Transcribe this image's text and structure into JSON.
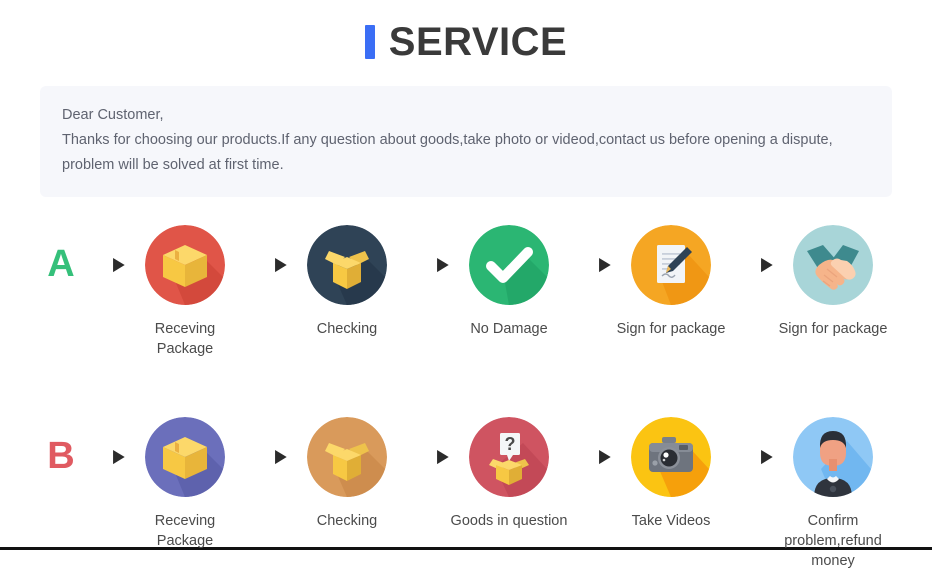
{
  "header": {
    "accent_color": "#3b6ef5",
    "title": "SERVICE"
  },
  "notice": {
    "line1": "Dear Customer,",
    "line2": "Thanks for choosing our products.If any question about goods,take photo or videod,contact us before opening a dispute,",
    "line3": "problem will be solved at first time.",
    "background": "#f6f7fb",
    "text_color": "#5f6370"
  },
  "flows": [
    {
      "letter": "A",
      "letter_color": "#35c07a",
      "steps": [
        {
          "icon": "package-box-icon",
          "label": "Receving Package",
          "circle_color": "#e05548"
        },
        {
          "icon": "open-box-icon",
          "label": "Checking",
          "circle_color": "#2f4356"
        },
        {
          "icon": "check-mark-icon",
          "label": "No Damage",
          "circle_color": "#2bb673"
        },
        {
          "icon": "sign-document-icon",
          "label": "Sign for package",
          "circle_color": "#f5a623"
        },
        {
          "icon": "handshake-icon",
          "label": "Sign for package",
          "circle_color": "#a8d5d8"
        }
      ]
    },
    {
      "letter": "B",
      "letter_color": "#e05a61",
      "steps": [
        {
          "icon": "package-box-icon",
          "label": "Receving Package",
          "circle_color": "#6b6fbb"
        },
        {
          "icon": "open-box-icon",
          "label": "Checking",
          "circle_color": "#d99a5b"
        },
        {
          "icon": "question-box-icon",
          "label": "Goods in question",
          "circle_color": "#cf5461"
        },
        {
          "icon": "camera-icon",
          "label": "Take Videos",
          "circle_color": "#fbc412"
        },
        {
          "icon": "support-person-icon",
          "label": "Confirm problem,refund money",
          "circle_color": "#8fc8f5"
        }
      ]
    }
  ],
  "arrow": {
    "name": "right-arrow-icon",
    "color": "#3d3d3d"
  }
}
